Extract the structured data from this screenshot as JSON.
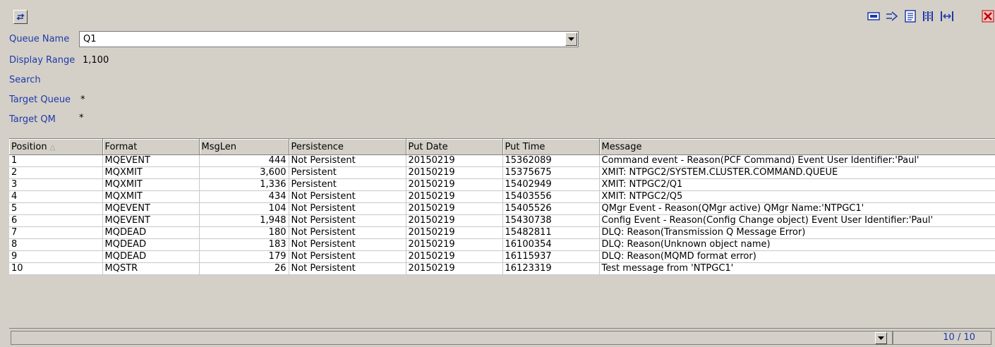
{
  "toolbar": {
    "refresh_icon": "refresh-arrows-icon",
    "right_icons": [
      "hex-view-icon",
      "forward-icon",
      "text-view-icon",
      "columns-icon",
      "fit-width-icon"
    ],
    "close_icon": "close-icon"
  },
  "filters": {
    "queue_name_label": "Queue Name",
    "queue_name_value": "Q1",
    "display_range_label": "Display Range",
    "display_range_value": "1,100",
    "search_label": "Search",
    "target_queue_label": "Target Queue",
    "target_queue_value": "*",
    "target_qm_label": "Target QM",
    "target_qm_value": "*"
  },
  "table": {
    "columns": [
      "Position",
      "Format",
      "MsgLen",
      "Persistence",
      "Put Date",
      "Put Time",
      "Message"
    ],
    "rows": [
      [
        "1",
        "MQEVENT",
        "444",
        "Not Persistent",
        "20150219",
        "15362089",
        "Command event - Reason(PCF Command) Event User Identifier:'Paul'"
      ],
      [
        "2",
        "MQXMIT",
        "3,600",
        "Persistent",
        "20150219",
        "15375675",
        "XMIT: NTPGC2/SYSTEM.CLUSTER.COMMAND.QUEUE"
      ],
      [
        "3",
        "MQXMIT",
        "1,336",
        "Persistent",
        "20150219",
        "15402949",
        "XMIT: NTPGC2/Q1"
      ],
      [
        "4",
        "MQXMIT",
        "434",
        "Not Persistent",
        "20150219",
        "15403556",
        "XMIT: NTPGC2/Q5"
      ],
      [
        "5",
        "MQEVENT",
        "104",
        "Not Persistent",
        "20150219",
        "15405526",
        "QMgr Event - Reason(QMgr active) QMgr Name:'NTPGC1'"
      ],
      [
        "6",
        "MQEVENT",
        "1,948",
        "Not Persistent",
        "20150219",
        "15430738",
        "Config Event - Reason(Config Change object) Event User Identifier:'Paul'"
      ],
      [
        "7",
        "MQDEAD",
        "180",
        "Not Persistent",
        "20150219",
        "15482811",
        "DLQ: Reason(Transmission Q Message Error)"
      ],
      [
        "8",
        "MQDEAD",
        "183",
        "Not Persistent",
        "20150219",
        "16100354",
        "DLQ: Reason(Unknown object name)"
      ],
      [
        "9",
        "MQDEAD",
        "179",
        "Not Persistent",
        "20150219",
        "16115937",
        "DLQ: Reason(MQMD format error)"
      ],
      [
        "10",
        "MQSTR",
        "26",
        "Not Persistent",
        "20150219",
        "16123319",
        "Test message from 'NTPGC1'"
      ]
    ]
  },
  "status": {
    "count": "10 / 10"
  }
}
